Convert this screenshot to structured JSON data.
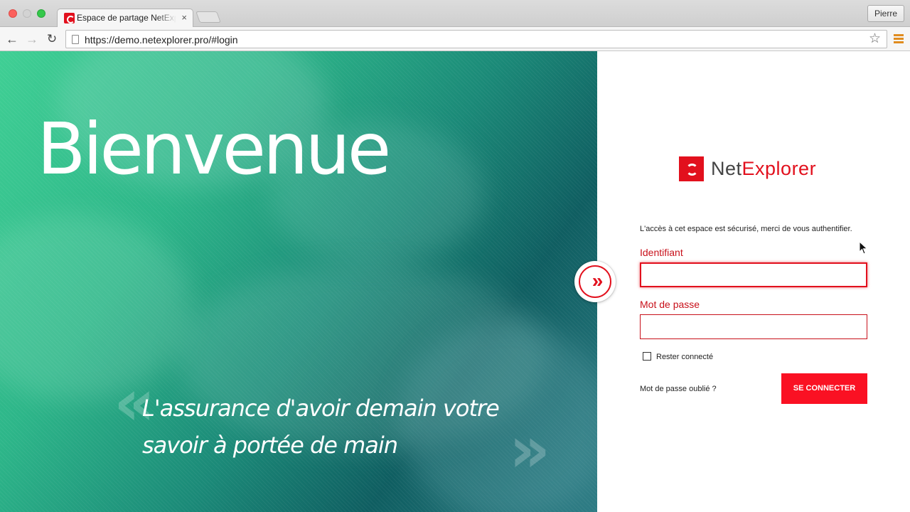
{
  "browser": {
    "tab_title": "Espace de partage NetExplorer",
    "tab_close": "×",
    "profile_name": "Pierre",
    "url": "https://demo.netexplorer.pro/#login",
    "back_icon": "←",
    "forward_icon": "→",
    "reload_icon": "↻",
    "star_icon": "☆"
  },
  "hero": {
    "title": "Bienvenue",
    "tagline": "L'assurance d'avoir demain votre savoir à portée de main",
    "quote_open": "«",
    "quote_close": "»"
  },
  "toggle": {
    "icon": "»"
  },
  "login": {
    "logo_part1": "Net",
    "logo_part2": "Explorer",
    "intro": "L'accès à cet espace est sécurisé, merci de vous authentifier.",
    "username_label": "Identifiant",
    "username_value": "",
    "password_label": "Mot de passe",
    "password_value": "",
    "remember_label": "Rester connecté",
    "remember_checked": false,
    "forgot_label": "Mot de passe oublié ?",
    "submit_label": "SE CONNECTER"
  },
  "colors": {
    "accent": "#e2101d",
    "button": "#fa1123",
    "label": "#c8101a"
  }
}
